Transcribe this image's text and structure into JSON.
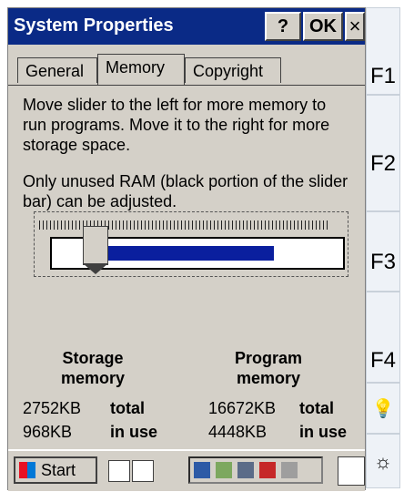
{
  "window": {
    "title": "System Properties",
    "help": "?",
    "ok": "OK",
    "close": "×"
  },
  "tabs": [
    {
      "label": "General"
    },
    {
      "label": "Memory",
      "active": true
    },
    {
      "label": "Copyright"
    }
  ],
  "memory": {
    "p1": "Move slider to the left for more memory to run programs. Move it to the right for more storage space.",
    "p2": "Only unused RAM (black portion of the slider bar) can be adjusted.",
    "storage_label": "Storage memory",
    "program_label": "Program memory",
    "storage_total_value": "2752KB",
    "storage_total_label": "total",
    "storage_inuse_value": "968KB",
    "storage_inuse_label": "in use",
    "program_total_value": "16672KB",
    "program_total_label": "total",
    "program_inuse_value": "4448KB",
    "program_inuse_label": "in use"
  },
  "taskbar": {
    "start": "Start"
  },
  "fkeys": {
    "f1": "F1",
    "f2": "F2",
    "f3": "F3",
    "f4": "F4",
    "bulb": "💡",
    "sun": "☼"
  },
  "colors": {
    "titlebar": "#0a2a86",
    "slider_fill": "#0a1f9e"
  }
}
